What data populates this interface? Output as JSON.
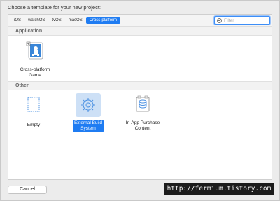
{
  "window": {
    "title": "Choose a template for your new project:"
  },
  "tabs": [
    {
      "label": "iOS"
    },
    {
      "label": "watchOS"
    },
    {
      "label": "tvOS"
    },
    {
      "label": "macOS"
    },
    {
      "label": "Cross-platform"
    }
  ],
  "active_tab": "Cross-platform",
  "filter": {
    "placeholder": "Filter"
  },
  "sections": [
    {
      "header": "Application",
      "items": [
        {
          "label": "Cross-platform\nGame",
          "icon": "game-template-icon",
          "selected": false
        }
      ]
    },
    {
      "header": "Other",
      "items": [
        {
          "label": "Empty",
          "icon": "empty-template-icon",
          "selected": false
        },
        {
          "label": "External Build\nSystem",
          "icon": "gear-icon",
          "selected": true
        },
        {
          "label": "In-App Purchase\nContent",
          "icon": "package-icon",
          "selected": false
        }
      ]
    }
  ],
  "buttons": {
    "cancel": "Cancel"
  },
  "watermark": "http://fermium.tistory.com",
  "colors": {
    "accent": "#1f7cf2",
    "selection_bg": "#cde0f6"
  }
}
